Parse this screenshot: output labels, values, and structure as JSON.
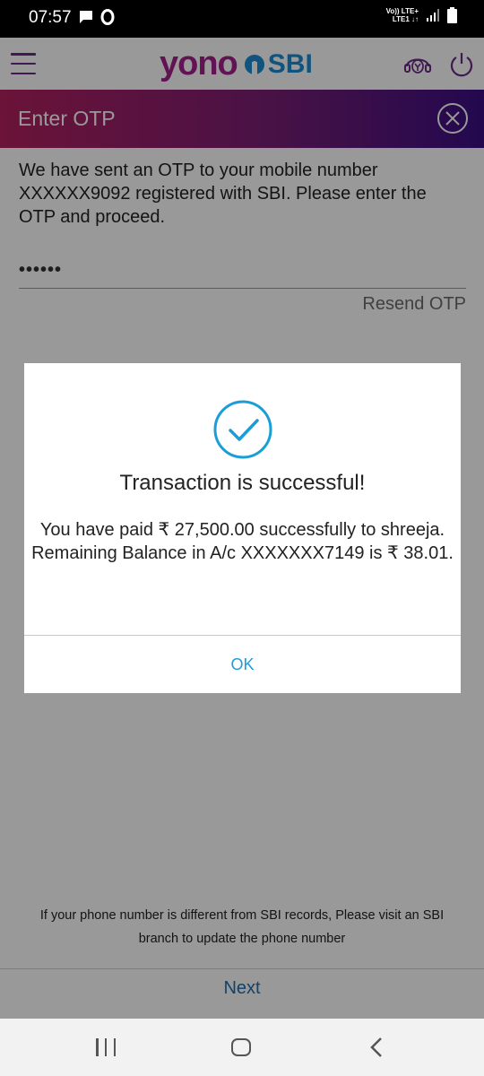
{
  "status_bar": {
    "time": "07:57",
    "network_line1": "Vo)) LTE+",
    "network_line2": "LTE1 ↓↑"
  },
  "header": {
    "logo_yono": "yono",
    "logo_sbi": "SBI"
  },
  "otp_section": {
    "title": "Enter OTP",
    "message": "We have sent an OTP to your mobile number XXXXXX9092 registered with SBI. Please enter the OTP and proceed.",
    "otp_value": "••••••",
    "resend_label": "Resend OTP"
  },
  "footer": {
    "note": "If your phone number is different from SBI records, Please visit an SBI branch to update the phone number",
    "next_label": "Next"
  },
  "dialog": {
    "title": "Transaction is successful!",
    "body": "You have paid ₹ 27,500.00 successfully to shreeja. Remaining Balance in A/c XXXXXXX7149 is ₹ 38.01.",
    "ok_label": "OK"
  },
  "colors": {
    "brand_purple": "#a3208c",
    "brand_blue": "#1a8bd2",
    "link_blue": "#1a9ed8"
  }
}
